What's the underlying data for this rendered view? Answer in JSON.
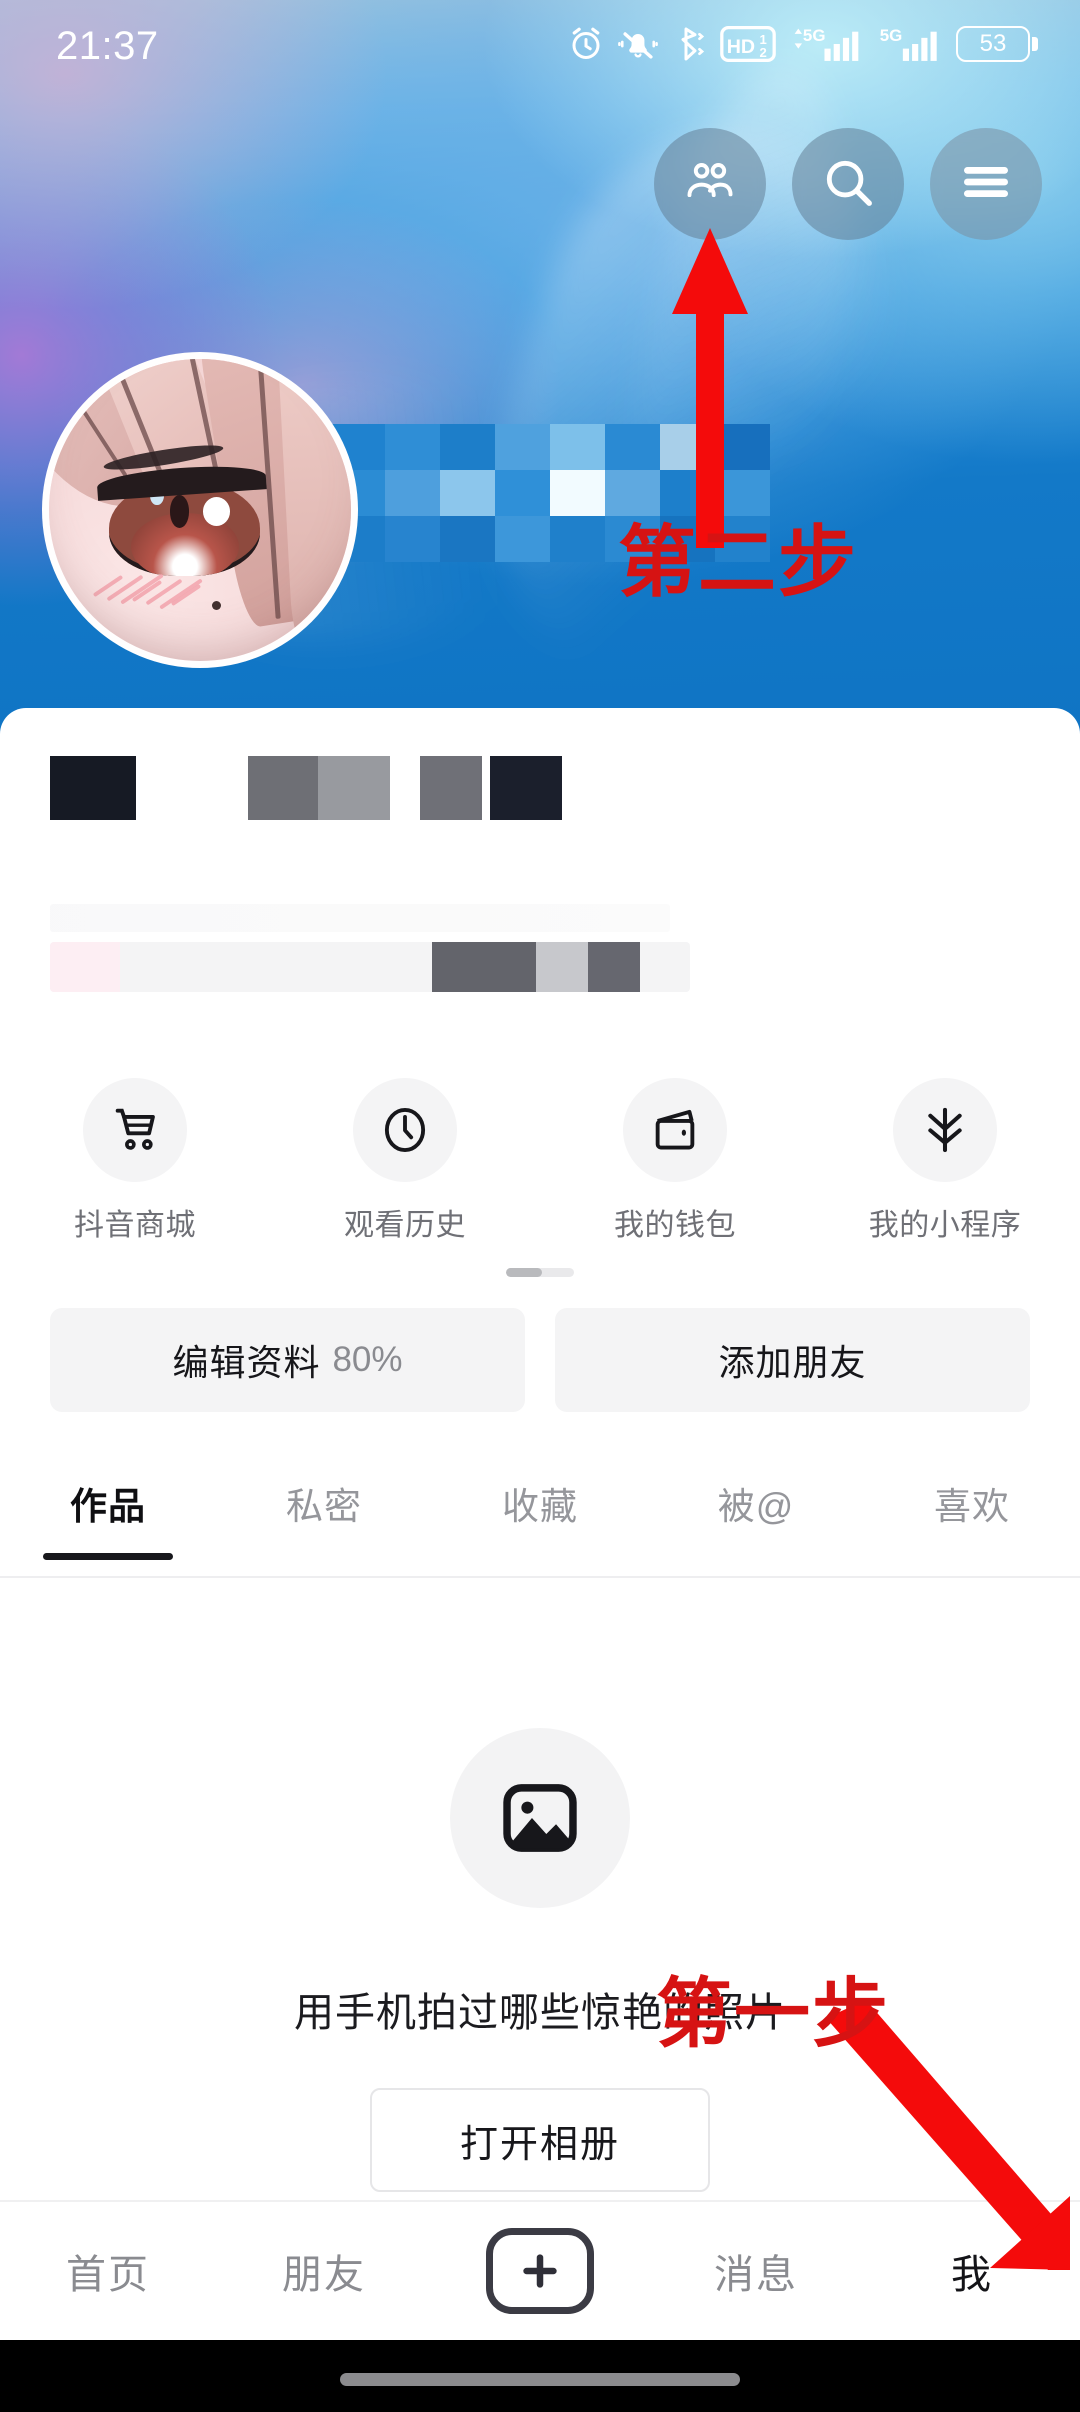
{
  "status_bar": {
    "time": "21:37",
    "battery_percent": "53",
    "network_label": "5G",
    "hd_label": "HD",
    "icons": [
      "alarm-icon",
      "bell-mute-icon",
      "bluetooth-icon",
      "hd-volte-icon",
      "signal-5g-primary-icon",
      "signal-5g-secondary-icon",
      "battery-icon"
    ]
  },
  "header": {
    "buttons": [
      {
        "name": "friends-button",
        "icon": "people-icon"
      },
      {
        "name": "search-button",
        "icon": "search-icon"
      },
      {
        "name": "menu-button",
        "icon": "hamburger-menu-icon"
      }
    ],
    "avatar_alt": "profile-avatar",
    "censored": true
  },
  "profile": {
    "name_censored": true,
    "bio_censored": true,
    "stats_censored": true
  },
  "quick_actions": [
    {
      "label": "抖音商城",
      "icon": "shopping-cart-icon"
    },
    {
      "label": "观看历史",
      "icon": "clock-icon"
    },
    {
      "label": "我的钱包",
      "icon": "wallet-icon"
    },
    {
      "label": "我的小程序",
      "icon": "mini-program-icon"
    }
  ],
  "action_buttons": {
    "edit_profile_label": "编辑资料",
    "edit_profile_percent": "80%",
    "add_friend_label": "添加朋友"
  },
  "tabs": [
    {
      "label": "作品",
      "active": true
    },
    {
      "label": "私密",
      "active": false
    },
    {
      "label": "收藏",
      "active": false
    },
    {
      "label": "被@",
      "active": false
    },
    {
      "label": "喜欢",
      "active": false
    }
  ],
  "empty_state": {
    "icon": "image-placeholder-icon",
    "text": "用手机拍过哪些惊艳的照片",
    "button_label": "打开相册"
  },
  "bottom_nav": [
    {
      "label": "首页",
      "active": false
    },
    {
      "label": "朋友",
      "active": false
    },
    {
      "label": "",
      "active": false,
      "icon": "plus-icon"
    },
    {
      "label": "消息",
      "active": false
    },
    {
      "label": "我",
      "active": true
    }
  ],
  "annotations": [
    {
      "name": "step-two",
      "text": "第二步",
      "color": "#d61313",
      "arrow": "arrow-up"
    },
    {
      "name": "step-one",
      "text": "第一步",
      "color": "#d61313",
      "arrow": "arrow-down"
    }
  ],
  "colors": {
    "annotation_red": "#d61313",
    "header_blue": "#1379c8",
    "sheet_white": "#ffffff",
    "chip_gray": "#f4f4f5",
    "text_primary": "#16161a",
    "text_muted": "#8a8b90"
  }
}
